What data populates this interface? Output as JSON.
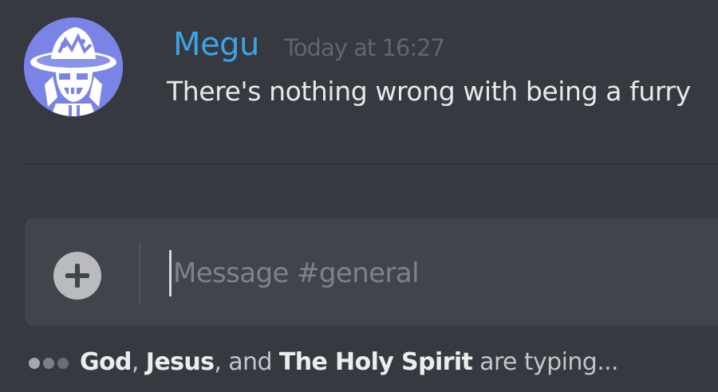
{
  "message": {
    "username": "Megu",
    "timestamp": "Today at 16:27",
    "text": "There's nothing wrong with being a furry",
    "avatar_icon": "witch-hat-skull-avatar",
    "username_color": "#3ba4e6",
    "avatar_color": "#7a84e6"
  },
  "composer": {
    "placeholder": "Message #general",
    "value": "",
    "upload_icon": "plus-circle-icon"
  },
  "typing": {
    "users": [
      "God",
      "Jesus",
      "The Holy Spirit"
    ],
    "separator_1": ", ",
    "separator_2": ", and ",
    "suffix": " are typing..."
  },
  "colors": {
    "background": "#36393f",
    "composer_background": "#40444b",
    "text": "#dcddde"
  }
}
